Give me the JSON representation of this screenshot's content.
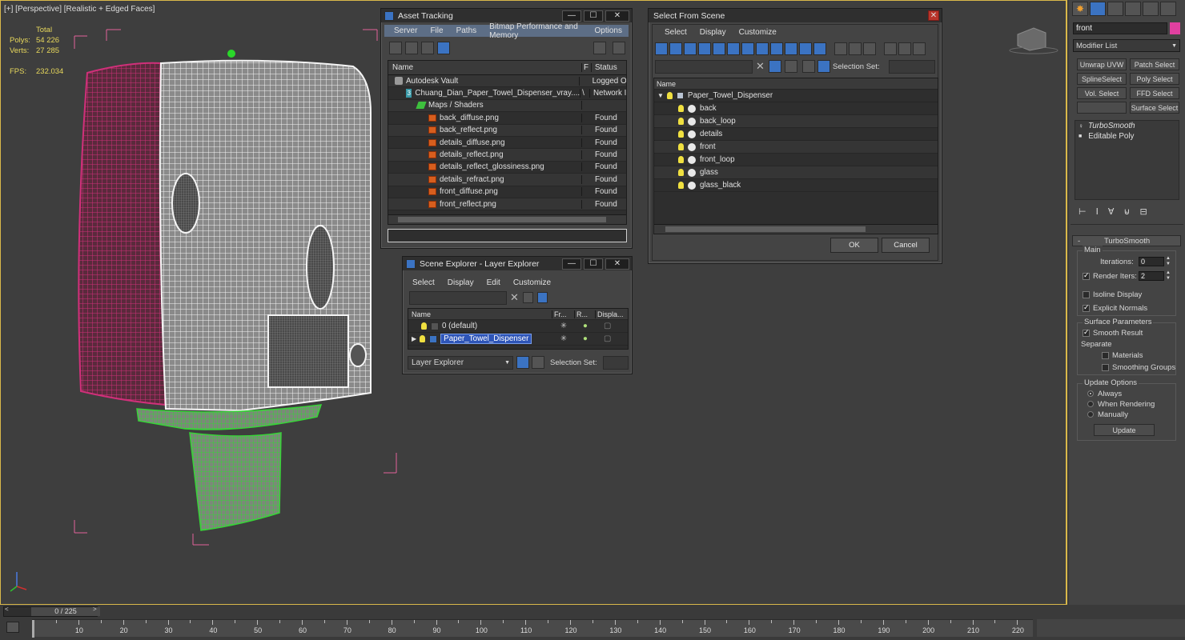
{
  "viewport": {
    "label": "[+] [Perspective] [Realistic + Edged Faces]",
    "stats": {
      "header": "Total",
      "polys_label": "Polys:",
      "polys": "54 226",
      "verts_label": "Verts:",
      "verts": "27 285",
      "fps_label": "FPS:",
      "fps": "232.034"
    }
  },
  "asset_tracking": {
    "title": "Asset Tracking",
    "menu": [
      "Server",
      "File",
      "Paths",
      "Bitmap Performance and Memory",
      "Options"
    ],
    "col_name": "Name",
    "col_f": "F",
    "col_status": "Status",
    "rows": [
      {
        "name": "Autodesk Vault",
        "f": "",
        "status": "Logged O",
        "indent": 0,
        "icon": "vault-icon"
      },
      {
        "name": "Chuang_Dian_Paper_Towel_Dispenser_vray....",
        "f": "\\",
        "status": "Network I",
        "indent": 1,
        "icon": "max-file-icon"
      },
      {
        "name": "Maps / Shaders",
        "f": "",
        "status": "",
        "indent": 2,
        "icon": "maps-icon"
      },
      {
        "name": "back_diffuse.png",
        "f": "",
        "status": "Found",
        "indent": 3,
        "icon": "png-icon"
      },
      {
        "name": "back_reflect.png",
        "f": "",
        "status": "Found",
        "indent": 3,
        "icon": "png-icon"
      },
      {
        "name": "details_diffuse.png",
        "f": "",
        "status": "Found",
        "indent": 3,
        "icon": "png-icon"
      },
      {
        "name": "details_reflect.png",
        "f": "",
        "status": "Found",
        "indent": 3,
        "icon": "png-icon"
      },
      {
        "name": "details_reflect_glossiness.png",
        "f": "",
        "status": "Found",
        "indent": 3,
        "icon": "png-icon"
      },
      {
        "name": "details_refract.png",
        "f": "",
        "status": "Found",
        "indent": 3,
        "icon": "png-icon"
      },
      {
        "name": "front_diffuse.png",
        "f": "",
        "status": "Found",
        "indent": 3,
        "icon": "png-icon"
      },
      {
        "name": "front_reflect.png",
        "f": "",
        "status": "Found",
        "indent": 3,
        "icon": "png-icon"
      }
    ]
  },
  "scene_explorer": {
    "title": "Scene Explorer - Layer Explorer",
    "menu": [
      "Select",
      "Display",
      "Edit",
      "Customize"
    ],
    "col_name": "Name",
    "col_fr": "Fr...",
    "col_r": "R...",
    "col_disp": "Displa...",
    "rows": [
      {
        "name": "0 (default)",
        "selected": false
      },
      {
        "name": "Paper_Towel_Dispenser",
        "selected": true
      }
    ],
    "dropdown": "Layer Explorer",
    "selection_set": "Selection Set:"
  },
  "select_from_scene": {
    "title": "Select From Scene",
    "menu": [
      "Select",
      "Display",
      "Customize"
    ],
    "selection_set": "Selection Set:",
    "col_name": "Name",
    "root": "Paper_Towel_Dispenser",
    "items": [
      "back",
      "back_loop",
      "details",
      "front",
      "front_loop",
      "glass",
      "glass_black"
    ],
    "ok": "OK",
    "cancel": "Cancel"
  },
  "command_panel": {
    "name_field": "front",
    "modifier_list": "Modifier List",
    "buttons": [
      "Unwrap UVW",
      "Patch Select",
      "SplineSelect",
      "Poly Select",
      "Vol. Select",
      "FFD Select",
      "",
      "Surface Select"
    ],
    "stack": [
      "TurboSmooth",
      "Editable Poly"
    ],
    "rollout_title": "TurboSmooth",
    "main_group": "Main",
    "iterations_label": "Iterations:",
    "iterations": "0",
    "render_iters_label": "Render Iters:",
    "render_iters": "2",
    "isoline": "Isoline Display",
    "explicit_normals": "Explicit Normals",
    "surface_group": "Surface Parameters",
    "smooth_result": "Smooth Result",
    "separate": "Separate",
    "materials": "Materials",
    "smoothing_groups": "Smoothing Groups",
    "update_group": "Update Options",
    "always": "Always",
    "when_rendering": "When Rendering",
    "manually": "Manually",
    "update_btn": "Update"
  },
  "timeline": {
    "frame": "0 / 225",
    "ticks": [
      "10",
      "20",
      "30",
      "40",
      "50",
      "60",
      "70",
      "80",
      "90",
      "100",
      "110",
      "120",
      "130",
      "140",
      "150",
      "160",
      "170",
      "180",
      "190",
      "200",
      "210",
      "220"
    ]
  },
  "colors": {
    "accent": "#3b73c2",
    "viewport_border": "#d9b84a",
    "wire_white": "#f0f0f0",
    "wire_magenta": "#d0307a",
    "wire_green": "#38d438",
    "bbox_pink": "#e2629b"
  }
}
